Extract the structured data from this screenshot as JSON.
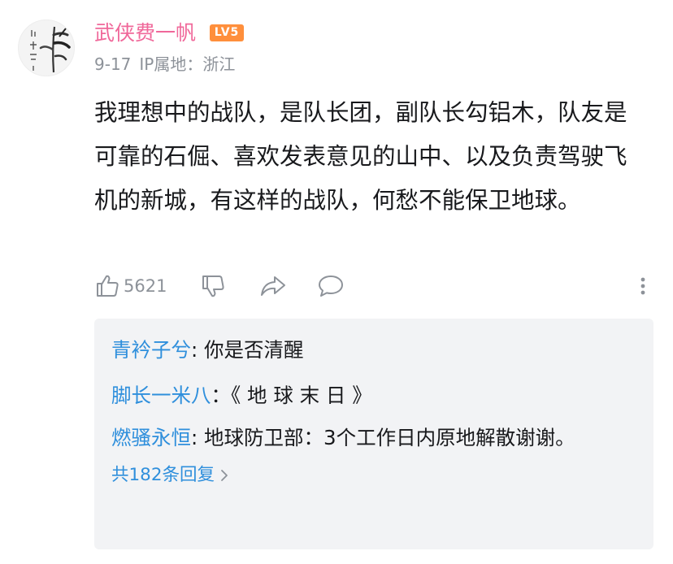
{
  "comment": {
    "username": "武侠费一帆",
    "level": "LV5",
    "date": "9-17",
    "ip_location": "IP属地：浙江",
    "text": "我理想中的战队，是队长团，副队长勾铝木，队友是可靠的石倔、喜欢发表意见的山中、以及负责驾驶飞机的新城，有这样的战队，何愁不能保卫地球。",
    "like_count": "5621"
  },
  "replies": [
    {
      "name": "青衿子兮",
      "separator": ": ",
      "text": "你是否清醒"
    },
    {
      "name": "脚长一米八",
      "separator": "：",
      "text": "《 地 球 末 日 》"
    },
    {
      "name": "燃骚永恒",
      "separator": ": ",
      "text": "地球防卫部：3个工作日内原地解散谢谢。"
    }
  ],
  "more_replies": "共182条回复",
  "colors": {
    "username": "#f0689a",
    "level_badge": "#ff8f3c",
    "link": "#2f8fdc",
    "meta": "#8d9299",
    "reply_bg": "#f2f3f5"
  },
  "icons": [
    "avatar-ink-bamboo",
    "thumbs-up-icon",
    "thumbs-down-icon",
    "share-icon",
    "reply-icon",
    "more-vertical-icon",
    "chevron-right-icon"
  ]
}
